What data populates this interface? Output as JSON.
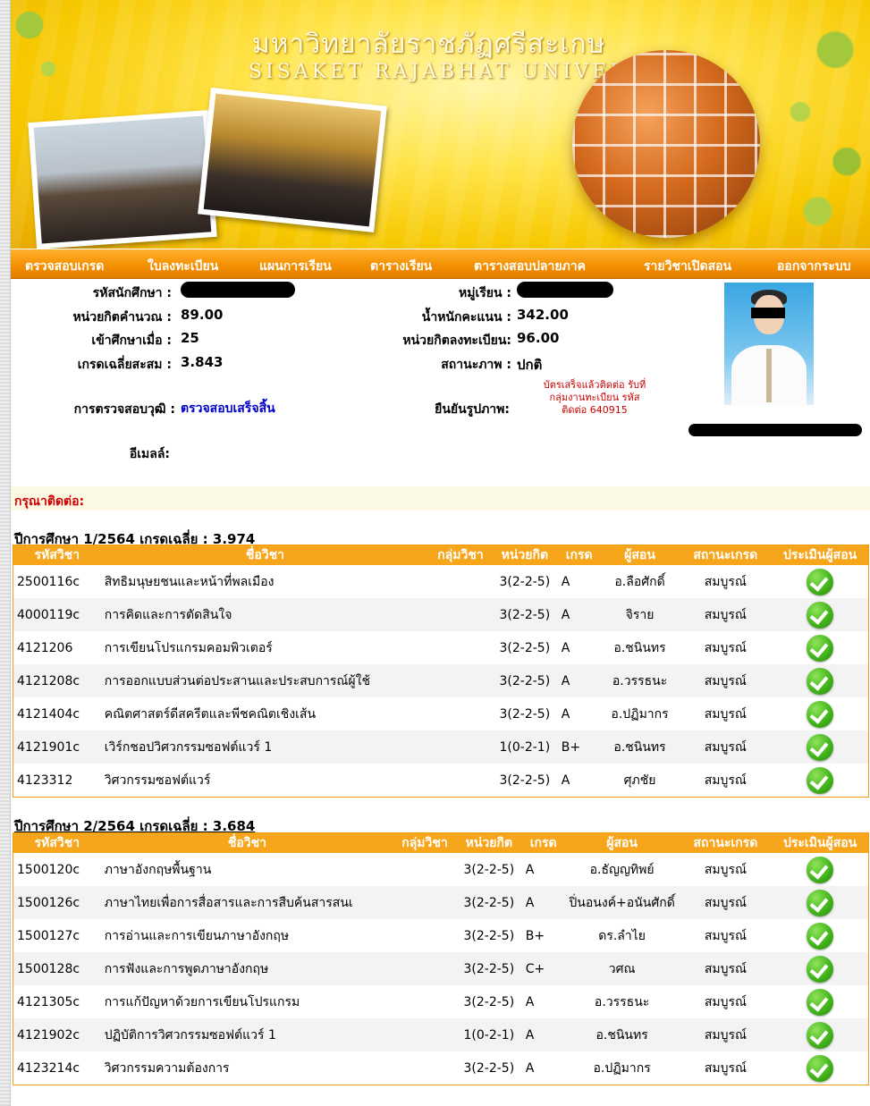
{
  "banner": {
    "title_th": "มหาวิทยาลัยราชภัฏศรีสะเกษ",
    "title_en": "SISAKET RAJABHAT UNIVERSITY"
  },
  "nav": [
    "ตรวจสอบเกรด",
    "ใบลงทะเบียน",
    "แผนการเรียน",
    "ตารางเรียน",
    "ตารางสอบปลายภาค",
    "รายวิชาเปิดสอน",
    "ออกจากระบบ"
  ],
  "student": {
    "id_label": "รหัสนักศึกษา :",
    "group_label": "หมู่เรียน :",
    "credits_calc_label": "หน่วยกิตคำนวณ :",
    "credits_calc": "89.00",
    "weight_label": "น้ำหนักคะแนน :",
    "weight": "342.00",
    "entry_label": "เข้าศึกษาเมื่อ :",
    "entry": "25",
    "credits_reg_label": "หน่วยกิตลงทะเบียน:",
    "credits_reg": "96.00",
    "gpa_label": "เกรดเฉลี่ยสะสม :",
    "gpa": "3.843",
    "status_label": "สถานะภาพ :",
    "status": "ปกติ",
    "degree_check_label": "การตรวจสอบวุฒิ :",
    "degree_check": "ตรวจสอบเสร็จสิ้น",
    "photo_confirm_label": "ยืนยันรูปภาพ:",
    "photo_note": "บัตรเสร็จแล้วติดต่อ รับที่กลุ่มงานทะเบียน รหัสติดต่อ 640915",
    "email_label": "อีเมลล์:"
  },
  "contact_label": "กรุณาติดต่อ:",
  "terms": [
    {
      "heading": "ปีการศึกษา 1/2564 เกรดเฉลี่ย : 3.974",
      "columns": [
        "รหัสวิชา",
        "ชื่อวิชา",
        "กลุ่มวิชา",
        "หน่วยกิต",
        "เกรด",
        "ผู้สอน",
        "สถานะเกรด",
        "ประเมินผู้สอน"
      ],
      "rows": [
        {
          "code": "2500116c",
          "name": "สิทธิมนุษยชนและหน้าที่พลเมือง",
          "credit": "3(2-2-5)",
          "grade": "A",
          "teacher": "อ.ลือศักดิ์",
          "status": "สมบูรณ์"
        },
        {
          "code": "4000119c",
          "name": "การคิดและการตัดสินใจ",
          "credit": "3(2-2-5)",
          "grade": "A",
          "teacher": "จิราย",
          "status": "สมบูรณ์"
        },
        {
          "code": "4121206",
          "name": "การเขียนโปรแกรมคอมพิวเตอร์",
          "credit": "3(2-2-5)",
          "grade": "A",
          "teacher": "อ.ชนินทร",
          "status": "สมบูรณ์"
        },
        {
          "code": "4121208c",
          "name": "การออกแบบส่วนต่อประสานและประสบการณ์ผู้ใช้",
          "credit": "3(2-2-5)",
          "grade": "A",
          "teacher": "อ.วรรธนะ",
          "status": "สมบูรณ์"
        },
        {
          "code": "4121404c",
          "name": "คณิตศาสตร์ดีสครีตและพีชคณิตเชิงเส้น",
          "credit": "3(2-2-5)",
          "grade": "A",
          "teacher": "อ.ปฏิมากร",
          "status": "สมบูรณ์"
        },
        {
          "code": "4121901c",
          "name": "เวิร์กชอปวิศวกรรมซอฟต์แวร์ 1",
          "credit": "1(0-2-1)",
          "grade": "B+",
          "teacher": "อ.ชนินทร",
          "status": "สมบูรณ์"
        },
        {
          "code": "4123312",
          "name": "วิศวกรรมซอฟต์แวร์",
          "credit": "3(2-2-5)",
          "grade": "A",
          "teacher": "ศุภชัย",
          "status": "สมบูรณ์"
        }
      ]
    },
    {
      "heading": "ปีการศึกษา 2/2564 เกรดเฉลี่ย : 3.684",
      "columns": [
        "รหัสวิชา",
        "ชื่อวิชา",
        "กลุ่มวิชา",
        "หน่วยกิต",
        "เกรด",
        "ผู้สอน",
        "สถานะเกรด",
        "ประเมินผู้สอน"
      ],
      "rows": [
        {
          "code": "1500120c",
          "name": "ภาษาอังกฤษพื้นฐาน",
          "credit": "3(2-2-5)",
          "grade": "A",
          "teacher": "อ.ธัญญทิพย์",
          "status": "สมบูรณ์"
        },
        {
          "code": "1500126c",
          "name": "ภาษาไทยเพื่อการสื่อสารและการสืบค้นสารสนเ",
          "credit": "3(2-2-5)",
          "grade": "A",
          "teacher": "ปิ่นอนงค์+อนันศักดิ์",
          "status": "สมบูรณ์"
        },
        {
          "code": "1500127c",
          "name": "การอ่านและการเขียนภาษาอังกฤษ",
          "credit": "3(2-2-5)",
          "grade": "B+",
          "teacher": "ดร.ลำไย",
          "status": "สมบูรณ์"
        },
        {
          "code": "1500128c",
          "name": "การฟังและการพูดภาษาอังกฤษ",
          "credit": "3(2-2-5)",
          "grade": "C+",
          "teacher": "วศณ",
          "status": "สมบูรณ์"
        },
        {
          "code": "4121305c",
          "name": "การแก้ปัญหาด้วยการเขียนโปรแกรม",
          "credit": "3(2-2-5)",
          "grade": "A",
          "teacher": "อ.วรรธนะ",
          "status": "สมบูรณ์"
        },
        {
          "code": "4121902c",
          "name": "ปฏิบัติการวิศวกรรมซอฟต์แวร์ 1",
          "credit": "1(0-2-1)",
          "grade": "A",
          "teacher": "อ.ชนินทร",
          "status": "สมบูรณ์"
        },
        {
          "code": "4123214c",
          "name": "วิศวกรรมความต้องการ",
          "credit": "3(2-2-5)",
          "grade": "A",
          "teacher": "อ.ปฏิมากร",
          "status": "สมบูรณ์"
        }
      ]
    }
  ],
  "icons": {
    "evaluate": "check-circle-icon"
  },
  "colors": {
    "nav_bg": "#f38e00",
    "table_header": "#f7a51b",
    "link_blue": "#0000cc",
    "note_red": "#cc0000",
    "check_green": "#43b51c"
  }
}
